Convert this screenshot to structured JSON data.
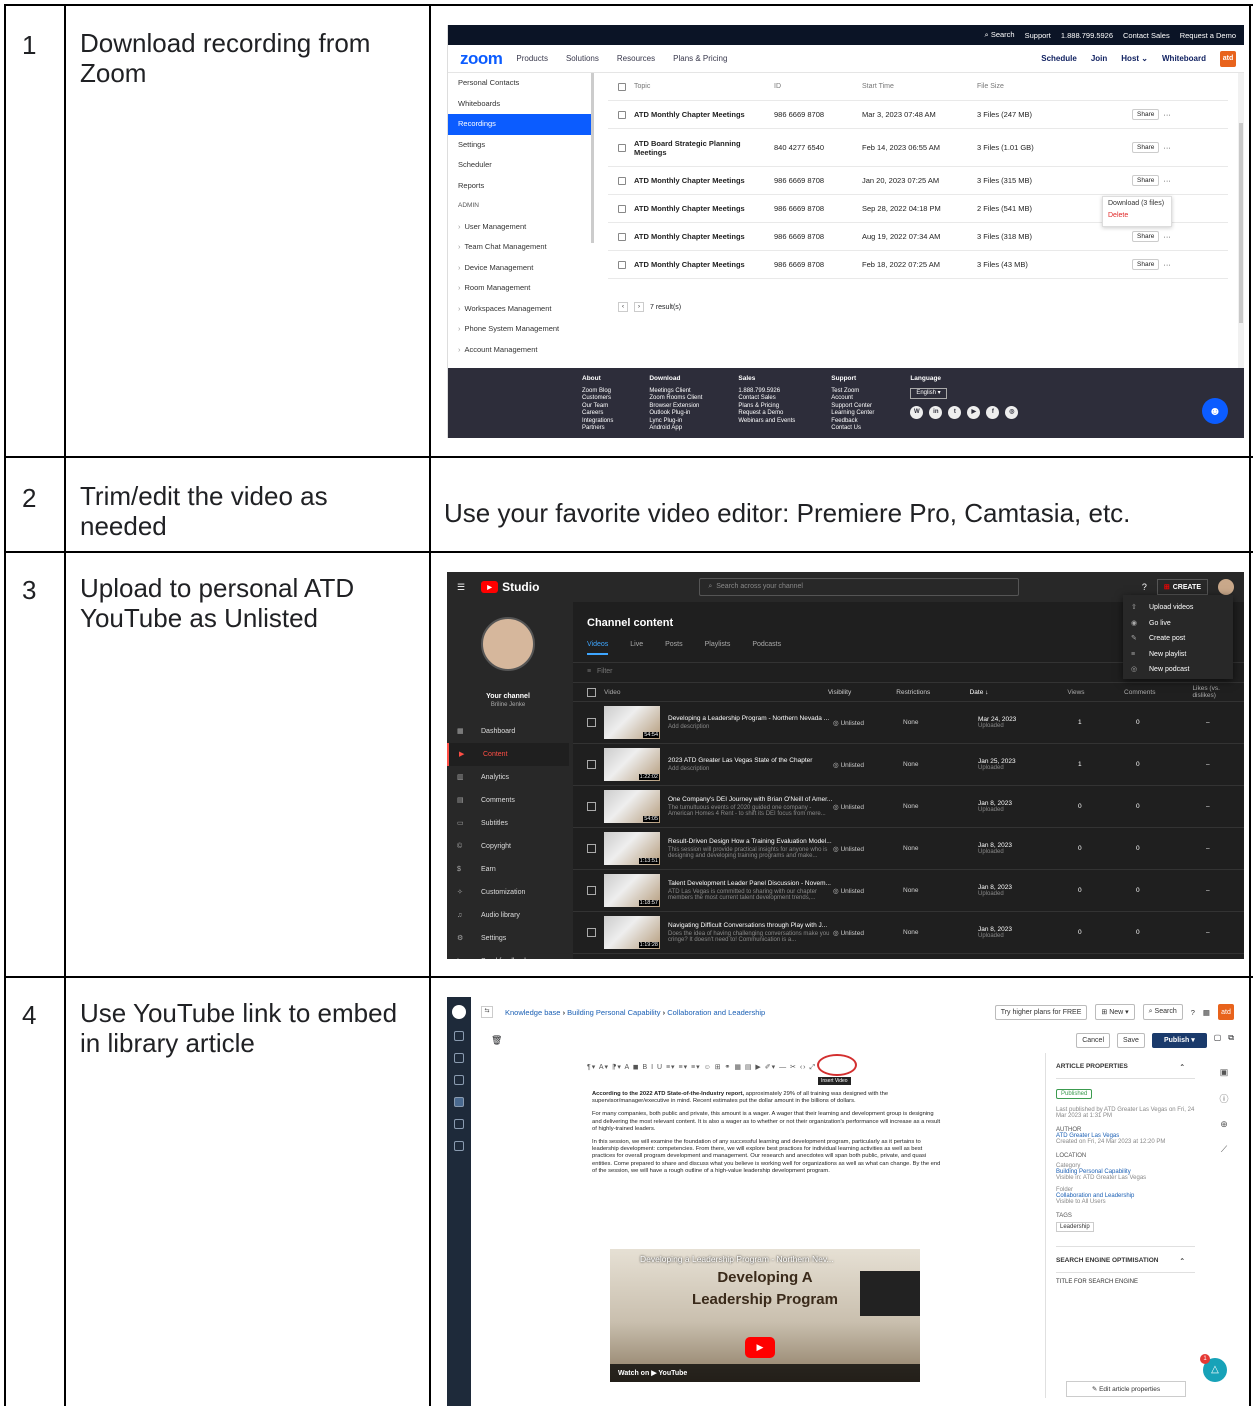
{
  "rows": [
    {
      "num": "1",
      "step": "Download recording from Zoom"
    },
    {
      "num": "2",
      "step": "Trim/edit the video as needed",
      "note": "Use your favorite video editor: Premiere Pro, Camtasia, etc."
    },
    {
      "num": "3",
      "step": "Upload to personal ATD YouTube as Unlisted"
    },
    {
      "num": "4",
      "step": "Use YouTube link to embed in library article"
    }
  ],
  "zoom": {
    "topbar": [
      "Search",
      "Support",
      "1.888.799.5926",
      "Contact Sales",
      "Request a Demo"
    ],
    "logo": "zoom",
    "nav": [
      "Products",
      "Solutions",
      "Resources",
      "Plans & Pricing"
    ],
    "nav_right": [
      "Schedule",
      "Join",
      "Host",
      "Whiteboard"
    ],
    "atd": "atd",
    "side": [
      "Personal Contacts",
      "Whiteboards",
      "Recordings",
      "Settings",
      "Scheduler",
      "Reports",
      "ADMIN",
      "User Management",
      "Team Chat Management",
      "Device Management",
      "Room Management",
      "Workspaces Management",
      "Phone System Management",
      "Account Management"
    ],
    "headers": [
      "Topic",
      "ID",
      "Start Time",
      "File Size"
    ],
    "rows": [
      {
        "topic": "ATD Monthly Chapter Meetings",
        "id": "986 6669 8708",
        "start": "Mar 3, 2023 07:48 AM",
        "size": "3 Files (247 MB)"
      },
      {
        "topic": "ATD Board Strategic Planning Meetings",
        "id": "840 4277 6540",
        "start": "Feb 14, 2023 06:55 AM",
        "size": "3 Files (1.01 GB)"
      },
      {
        "topic": "ATD Monthly Chapter Meetings",
        "id": "986 6669 8708",
        "start": "Jan 20, 2023 07:25 AM",
        "size": "3 Files (315 MB)"
      },
      {
        "topic": "ATD Monthly Chapter Meetings",
        "id": "986 6669 8708",
        "start": "Sep 28, 2022 04:18 PM",
        "size": "2 Files (541 MB)"
      },
      {
        "topic": "ATD Monthly Chapter Meetings",
        "id": "986 6669 8708",
        "start": "Aug 19, 2022 07:34 AM",
        "size": "3 Files (318 MB)"
      },
      {
        "topic": "ATD Monthly Chapter Meetings",
        "id": "986 6669 8708",
        "start": "Feb 18, 2022 07:25 AM",
        "size": "3 Files (43 MB)"
      }
    ],
    "share": "Share",
    "more": "···",
    "results": "7 result(s)",
    "menu_download": "Download (3 files)",
    "menu_delete": "Delete",
    "footer": [
      {
        "h": "About",
        "items": [
          "Zoom Blog",
          "Customers",
          "Our Team",
          "Careers",
          "Integrations",
          "Partners"
        ]
      },
      {
        "h": "Download",
        "items": [
          "Meetings Client",
          "Zoom Rooms Client",
          "Browser Extension",
          "Outlook Plug-in",
          "Lync Plug-in",
          "Android App"
        ]
      },
      {
        "h": "Sales",
        "items": [
          "1.888.799.5926",
          "Contact Sales",
          "Plans & Pricing",
          "Request a Demo",
          "Webinars and Events"
        ]
      },
      {
        "h": "Support",
        "items": [
          "Test Zoom",
          "Account",
          "Support Center",
          "Learning Center",
          "Feedback",
          "Contact Us"
        ]
      }
    ],
    "language": "Language",
    "english": "English"
  },
  "youtube": {
    "studio": "Studio",
    "search": "Search across your channel",
    "create": "CREATE",
    "your_channel": "Your channel",
    "channel_name": "Briline Jenke",
    "side": [
      "Dashboard",
      "Content",
      "Analytics",
      "Comments",
      "Subtitles",
      "Copyright",
      "Earn",
      "Customization",
      "Audio library",
      "Settings",
      "Send feedback"
    ],
    "heading": "Channel content",
    "tabs": [
      "Videos",
      "Live",
      "Posts",
      "Playlists",
      "Podcasts"
    ],
    "filter": "Filter",
    "headers": [
      "Video",
      "Visibility",
      "Restrictions",
      "Date ↓",
      "Views",
      "Comments",
      "Likes (vs. dislikes)"
    ],
    "rows": [
      {
        "title": "Developing a Leadership Program - Northern Nevada ...",
        "desc": "Add description",
        "dur": "54:54",
        "vis": "Unlisted",
        "res": "None",
        "date": "Mar 24, 2023",
        "views": "1",
        "comments": "0",
        "likes": "–"
      },
      {
        "title": "2023 ATD Greater Las Vegas State of the Chapter",
        "desc": "Add description",
        "dur": "1:22:02",
        "vis": "Unlisted",
        "res": "None",
        "date": "Jan 25, 2023",
        "views": "1",
        "comments": "0",
        "likes": "–"
      },
      {
        "title": "One Company's DEI Journey with Brian O'Neill of Amer...",
        "desc": "The tumultuous events of 2020 guided one company - American Homes 4 Rent - to shift its DEI focus from mere...",
        "dur": "54:05",
        "vis": "Unlisted",
        "res": "None",
        "date": "Jan 8, 2023",
        "views": "0",
        "comments": "0",
        "likes": "–"
      },
      {
        "title": "Result-Driven Design How a Training Evaluation Model...",
        "desc": "This session will provide practical insights for anyone who is designing and developing training programs and make...",
        "dur": "1:13:51",
        "vis": "Unlisted",
        "res": "None",
        "date": "Jan 8, 2023",
        "views": "0",
        "comments": "0",
        "likes": "–"
      },
      {
        "title": "Talent Development Leader Panel Discussion - Novem...",
        "desc": "ATD Las Vegas is committed to sharing with our chapter members the most current talent development trends,...",
        "dur": "1:18:57",
        "vis": "Unlisted",
        "res": "None",
        "date": "Jan 8, 2023",
        "views": "0",
        "comments": "0",
        "likes": "–"
      },
      {
        "title": "Navigating Difficult Conversations through Play with J...",
        "desc": "Does the idea of having challenging conversations make you cringe? It doesn't need to! Communication is a...",
        "dur": "1:19:28",
        "vis": "Unlisted",
        "res": "None",
        "date": "Jan 8, 2023",
        "views": "0",
        "comments": "0",
        "likes": "–"
      }
    ],
    "uploaded": "Uploaded",
    "menu": [
      "Upload videos",
      "Go live",
      "Create post",
      "New playlist",
      "New podcast"
    ]
  },
  "kb": {
    "crumb1": "Knowledge base",
    "crumb2": "Building Personal Capability",
    "crumb3": "Collaboration and Leadership",
    "try": "Try higher plans for FREE",
    "new": "New",
    "search": "Search",
    "atd": "atd",
    "cancel": "Cancel",
    "save": "Save",
    "publish": "Publish",
    "tooltip": "Insert Video",
    "p1_bold": "According to the 2022 ATD State-of-the-Industry report,",
    "p1": "approximately 29% of all training was designed with the supervisor/manager/executive in mind. Recent estimates put the dollar amount in the billions of dollars.",
    "p2": "For many companies, both public and private, this amount is a wager. A wager that their learning and development group is designing and delivering the most relevant content. It is also a wager as to whether or not their organization's performance will increase as a result of highly-trained leaders.",
    "p3": "In this session, we will examine the foundation of any successful learning and development program, particularly as it pertains to leadership development: competencies. From there, we will explore best practices for individual learning activities as well as best practices for overall program development and management. Our research and anecdotes will span both public, private, and quasi entities. Come prepared to share and discuss what you believe is working well for organizations as well as what can change. By the end of the session, we will have a rough outline of a high-value leadership development program.",
    "video_title": "Developing a Leadership Program - Northern Nev...",
    "video_big1": "Developing A",
    "video_big2": "Leadership Program",
    "watch_on": "Watch on",
    "youtube": "YouTube",
    "props_title": "ARTICLE PROPERTIES",
    "published": "Published",
    "last_pub": "Last published by ATD Greater Las Vegas on Fri, 24 Mar 2023 at 1:31 PM",
    "author_lbl": "AUTHOR",
    "author": "ATD Greater Las Vegas",
    "created": "Created on Fri, 24 Mar 2023 at 12:20 PM",
    "location_lbl": "LOCATION",
    "category_lbl": "Category",
    "category": "Building Personal Capability",
    "cat_vis": "Visible in: ATD Greater Las Vegas",
    "folder_lbl": "Folder",
    "folder": "Collaboration and Leadership",
    "folder_vis": "Visible to All Users",
    "tags_lbl": "TAGS",
    "tag": "Leadership",
    "seo": "SEARCH ENGINE OPTIMISATION",
    "seo_title": "TITLE FOR SEARCH ENGINE",
    "edit": "Edit article properties",
    "badge": "1"
  }
}
